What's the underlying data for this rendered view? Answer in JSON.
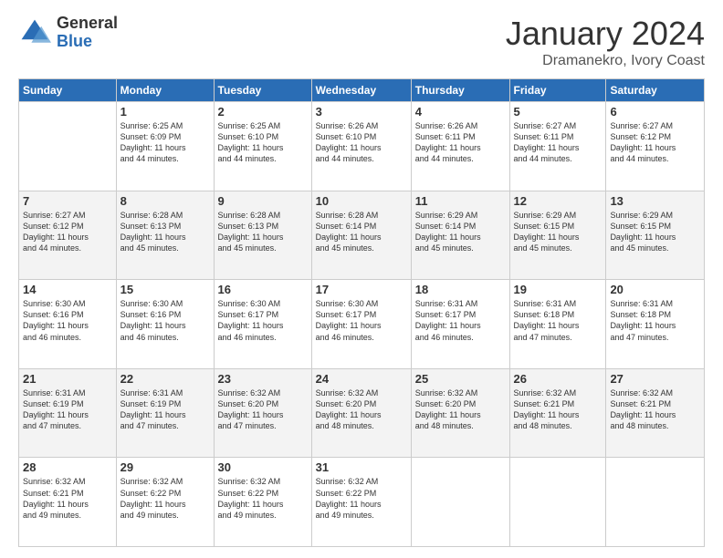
{
  "header": {
    "logo": {
      "general": "General",
      "blue": "Blue"
    },
    "title": "January 2024",
    "subtitle": "Dramanekro, Ivory Coast"
  },
  "days_of_week": [
    "Sunday",
    "Monday",
    "Tuesday",
    "Wednesday",
    "Thursday",
    "Friday",
    "Saturday"
  ],
  "weeks": [
    [
      {
        "day": "",
        "info": ""
      },
      {
        "day": "1",
        "info": "Sunrise: 6:25 AM\nSunset: 6:09 PM\nDaylight: 11 hours\nand 44 minutes."
      },
      {
        "day": "2",
        "info": "Sunrise: 6:25 AM\nSunset: 6:10 PM\nDaylight: 11 hours\nand 44 minutes."
      },
      {
        "day": "3",
        "info": "Sunrise: 6:26 AM\nSunset: 6:10 PM\nDaylight: 11 hours\nand 44 minutes."
      },
      {
        "day": "4",
        "info": "Sunrise: 6:26 AM\nSunset: 6:11 PM\nDaylight: 11 hours\nand 44 minutes."
      },
      {
        "day": "5",
        "info": "Sunrise: 6:27 AM\nSunset: 6:11 PM\nDaylight: 11 hours\nand 44 minutes."
      },
      {
        "day": "6",
        "info": "Sunrise: 6:27 AM\nSunset: 6:12 PM\nDaylight: 11 hours\nand 44 minutes."
      }
    ],
    [
      {
        "day": "7",
        "info": "Sunrise: 6:27 AM\nSunset: 6:12 PM\nDaylight: 11 hours\nand 44 minutes."
      },
      {
        "day": "8",
        "info": "Sunrise: 6:28 AM\nSunset: 6:13 PM\nDaylight: 11 hours\nand 45 minutes."
      },
      {
        "day": "9",
        "info": "Sunrise: 6:28 AM\nSunset: 6:13 PM\nDaylight: 11 hours\nand 45 minutes."
      },
      {
        "day": "10",
        "info": "Sunrise: 6:28 AM\nSunset: 6:14 PM\nDaylight: 11 hours\nand 45 minutes."
      },
      {
        "day": "11",
        "info": "Sunrise: 6:29 AM\nSunset: 6:14 PM\nDaylight: 11 hours\nand 45 minutes."
      },
      {
        "day": "12",
        "info": "Sunrise: 6:29 AM\nSunset: 6:15 PM\nDaylight: 11 hours\nand 45 minutes."
      },
      {
        "day": "13",
        "info": "Sunrise: 6:29 AM\nSunset: 6:15 PM\nDaylight: 11 hours\nand 45 minutes."
      }
    ],
    [
      {
        "day": "14",
        "info": "Sunrise: 6:30 AM\nSunset: 6:16 PM\nDaylight: 11 hours\nand 46 minutes."
      },
      {
        "day": "15",
        "info": "Sunrise: 6:30 AM\nSunset: 6:16 PM\nDaylight: 11 hours\nand 46 minutes."
      },
      {
        "day": "16",
        "info": "Sunrise: 6:30 AM\nSunset: 6:17 PM\nDaylight: 11 hours\nand 46 minutes."
      },
      {
        "day": "17",
        "info": "Sunrise: 6:30 AM\nSunset: 6:17 PM\nDaylight: 11 hours\nand 46 minutes."
      },
      {
        "day": "18",
        "info": "Sunrise: 6:31 AM\nSunset: 6:17 PM\nDaylight: 11 hours\nand 46 minutes."
      },
      {
        "day": "19",
        "info": "Sunrise: 6:31 AM\nSunset: 6:18 PM\nDaylight: 11 hours\nand 47 minutes."
      },
      {
        "day": "20",
        "info": "Sunrise: 6:31 AM\nSunset: 6:18 PM\nDaylight: 11 hours\nand 47 minutes."
      }
    ],
    [
      {
        "day": "21",
        "info": "Sunrise: 6:31 AM\nSunset: 6:19 PM\nDaylight: 11 hours\nand 47 minutes."
      },
      {
        "day": "22",
        "info": "Sunrise: 6:31 AM\nSunset: 6:19 PM\nDaylight: 11 hours\nand 47 minutes."
      },
      {
        "day": "23",
        "info": "Sunrise: 6:32 AM\nSunset: 6:20 PM\nDaylight: 11 hours\nand 47 minutes."
      },
      {
        "day": "24",
        "info": "Sunrise: 6:32 AM\nSunset: 6:20 PM\nDaylight: 11 hours\nand 48 minutes."
      },
      {
        "day": "25",
        "info": "Sunrise: 6:32 AM\nSunset: 6:20 PM\nDaylight: 11 hours\nand 48 minutes."
      },
      {
        "day": "26",
        "info": "Sunrise: 6:32 AM\nSunset: 6:21 PM\nDaylight: 11 hours\nand 48 minutes."
      },
      {
        "day": "27",
        "info": "Sunrise: 6:32 AM\nSunset: 6:21 PM\nDaylight: 11 hours\nand 48 minutes."
      }
    ],
    [
      {
        "day": "28",
        "info": "Sunrise: 6:32 AM\nSunset: 6:21 PM\nDaylight: 11 hours\nand 49 minutes."
      },
      {
        "day": "29",
        "info": "Sunrise: 6:32 AM\nSunset: 6:22 PM\nDaylight: 11 hours\nand 49 minutes."
      },
      {
        "day": "30",
        "info": "Sunrise: 6:32 AM\nSunset: 6:22 PM\nDaylight: 11 hours\nand 49 minutes."
      },
      {
        "day": "31",
        "info": "Sunrise: 6:32 AM\nSunset: 6:22 PM\nDaylight: 11 hours\nand 49 minutes."
      },
      {
        "day": "",
        "info": ""
      },
      {
        "day": "",
        "info": ""
      },
      {
        "day": "",
        "info": ""
      }
    ]
  ]
}
